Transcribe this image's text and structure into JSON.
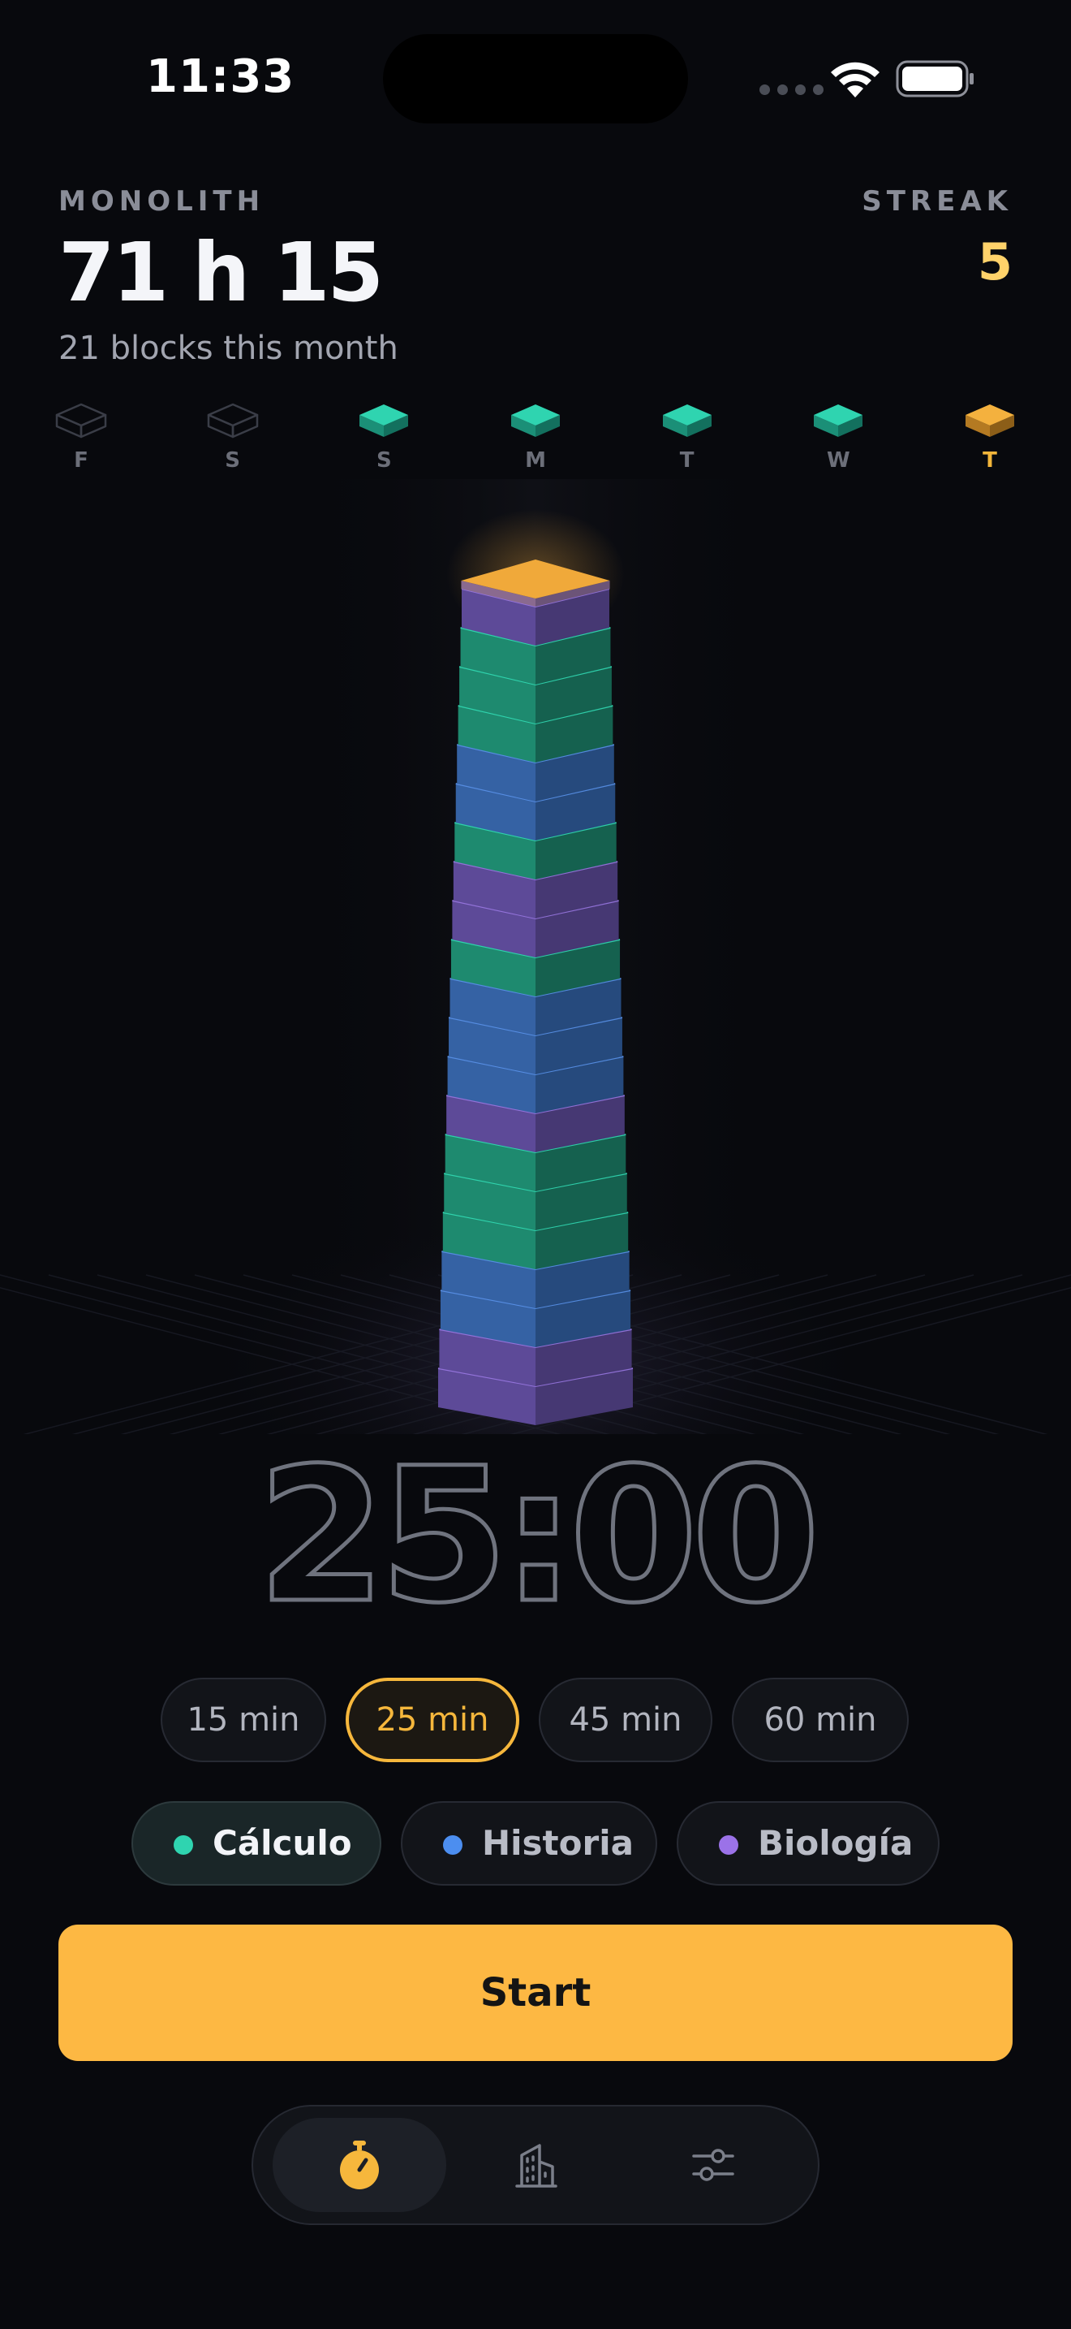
{
  "status": {
    "time": "11:33"
  },
  "header": {
    "brand": "MONOLITH",
    "total_time": "71 h 15",
    "subtitle": "21 blocks this month",
    "streak_label": "STREAK",
    "streak_value": "5"
  },
  "week": {
    "days": [
      {
        "label": "F",
        "state": "empty"
      },
      {
        "label": "S",
        "state": "empty"
      },
      {
        "label": "S",
        "state": "done"
      },
      {
        "label": "M",
        "state": "done"
      },
      {
        "label": "T",
        "state": "done"
      },
      {
        "label": "W",
        "state": "done"
      },
      {
        "label": "T",
        "state": "today"
      }
    ]
  },
  "tower": {
    "blocks_bottom_to_top": [
      "purple",
      "purple",
      "blue",
      "blue",
      "green",
      "green",
      "green",
      "purple",
      "blue",
      "blue",
      "blue",
      "green",
      "purple",
      "purple",
      "green",
      "blue",
      "blue",
      "green",
      "green",
      "green",
      "purple"
    ],
    "cap_color": "#f0a93a"
  },
  "timer": {
    "display": "25:00"
  },
  "durations": [
    {
      "label": "15 min",
      "active": false
    },
    {
      "label": "25 min",
      "active": true
    },
    {
      "label": "45 min",
      "active": false
    },
    {
      "label": "60 min",
      "active": false
    }
  ],
  "subjects": [
    {
      "label": "Cálculo",
      "color": "#2fd4b0",
      "active": true
    },
    {
      "label": "Historia",
      "color": "#4c8ef0",
      "active": false
    },
    {
      "label": "Biología",
      "color": "#9b72e8",
      "active": false
    }
  ],
  "start_label": "Start",
  "tabs": [
    {
      "icon": "stopwatch-icon",
      "active": true
    },
    {
      "icon": "building-icon",
      "active": false
    },
    {
      "icon": "sliders-icon",
      "active": false
    }
  ],
  "colors": {
    "accent": "#fdb843",
    "green": "#2fd4b0",
    "blue": "#4c8ef0",
    "purple": "#9b72e8"
  }
}
